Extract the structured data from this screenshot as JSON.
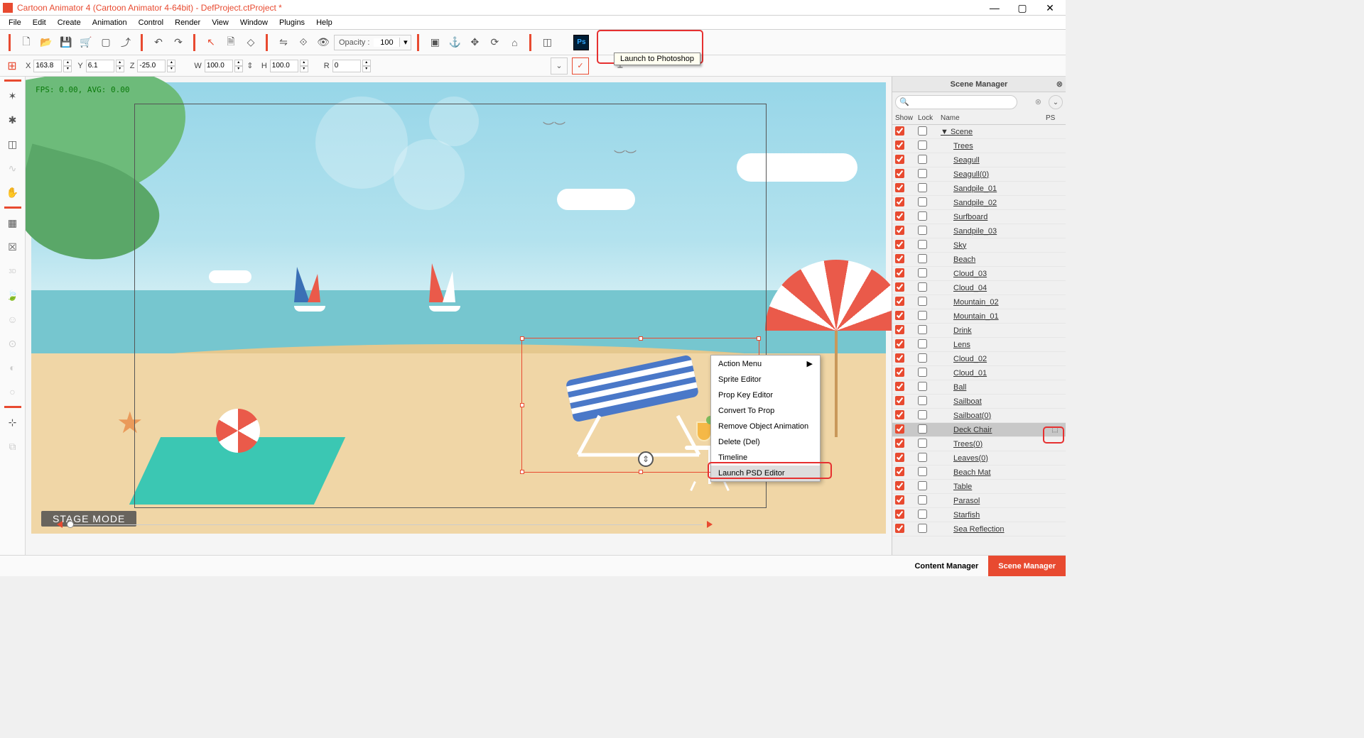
{
  "app": {
    "title": "Cartoon Animator 4  (Cartoon Animator 4-64bit) - DefProject.ctProject *"
  },
  "menu": [
    "File",
    "Edit",
    "Create",
    "Animation",
    "Control",
    "Render",
    "View",
    "Window",
    "Plugins",
    "Help"
  ],
  "toolbar": {
    "opacity_label": "Opacity :",
    "opacity_value": "100",
    "ps_tooltip": "Launch to Photoshop",
    "ps_label": "Ps"
  },
  "props": {
    "x": "163.8",
    "y": "6.1",
    "z": "-25.0",
    "w": "100.0",
    "h": "100.0",
    "r": "0"
  },
  "stage": {
    "fps": "FPS: 0.00, AVG: 0.00",
    "mode_label": "STAGE MODE"
  },
  "contextMenu": {
    "items": [
      {
        "label": "Action Menu",
        "hasSub": true
      },
      {
        "label": "Sprite Editor"
      },
      {
        "label": "Prop Key Editor"
      },
      {
        "label": "Convert To Prop"
      },
      {
        "label": "Remove Object Animation"
      },
      {
        "label": "Delete (Del)"
      },
      {
        "label": "Timeline"
      },
      {
        "label": "Launch PSD Editor",
        "highlighted": true
      }
    ]
  },
  "sceneManager": {
    "title": "Scene Manager",
    "searchPlaceholder": "",
    "columns": {
      "show": "Show",
      "lock": "Lock",
      "name": "Name",
      "ps": "PS"
    },
    "items": [
      {
        "name": "Scene",
        "root": true,
        "show": true
      },
      {
        "name": "Trees",
        "show": true
      },
      {
        "name": "Seagull",
        "show": true
      },
      {
        "name": "Seagull(0)",
        "show": true
      },
      {
        "name": "Sandpile_01",
        "show": true
      },
      {
        "name": "Sandpile_02",
        "show": true
      },
      {
        "name": "Surfboard",
        "show": true
      },
      {
        "name": "Sandpile_03",
        "show": true
      },
      {
        "name": "Sky",
        "show": true
      },
      {
        "name": "Beach",
        "show": true
      },
      {
        "name": "Cloud_03",
        "show": true
      },
      {
        "name": "Cloud_04",
        "show": true
      },
      {
        "name": "Mountain_02",
        "show": true
      },
      {
        "name": "Mountain_01",
        "show": true
      },
      {
        "name": "Drink",
        "show": true
      },
      {
        "name": "Lens",
        "show": true
      },
      {
        "name": "Cloud_02",
        "show": true
      },
      {
        "name": "Cloud_01",
        "show": true
      },
      {
        "name": "Ball",
        "show": true
      },
      {
        "name": "Sailboat",
        "show": true
      },
      {
        "name": "Sailboat(0)",
        "show": true
      },
      {
        "name": "Deck Chair",
        "show": true,
        "selected": true,
        "ps": true
      },
      {
        "name": "Trees(0)",
        "show": true
      },
      {
        "name": "Leaves(0)",
        "show": true
      },
      {
        "name": "Beach Mat",
        "show": true
      },
      {
        "name": "Table",
        "show": true
      },
      {
        "name": "Parasol",
        "show": true
      },
      {
        "name": "Starfish",
        "show": true
      },
      {
        "name": "Sea Reflection",
        "show": true
      }
    ]
  },
  "bottomTabs": {
    "content": "Content Manager",
    "scene": "Scene Manager"
  },
  "playback": {
    "frame": "1"
  }
}
